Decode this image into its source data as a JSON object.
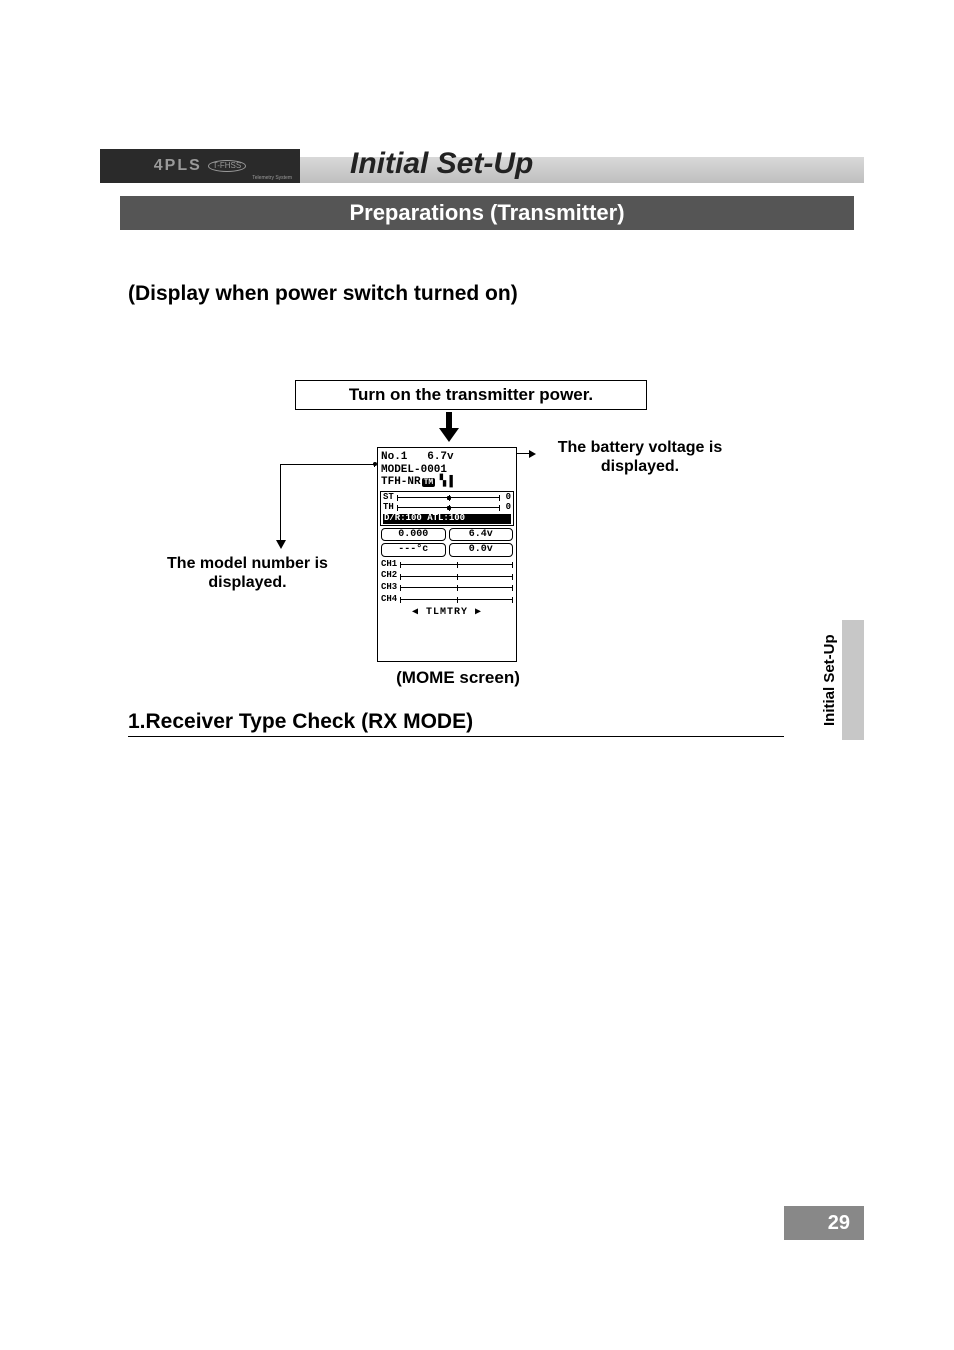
{
  "header": {
    "logo": "4PLS",
    "logo_badge": "T-FHSS",
    "logo_sub": "Telemetry System",
    "title": "Initial Set-Up",
    "section": "Preparations (Transmitter)"
  },
  "sub_heading": "(Display when power switch turned on)",
  "instruction": "Turn on the transmitter power.",
  "callouts": {
    "right": "The battery voltage  is displayed.",
    "left": "The model number is displayed.",
    "mome": "(MOME screen)"
  },
  "lcd": {
    "line1_left": "No.1",
    "line1_right": "6.7v",
    "line2": "MODEL-0001",
    "line3_prefix": "TFH-NR",
    "line3_icons": [
      "TM",
      "↕"
    ],
    "box1": {
      "st": "ST",
      "st_val": "0",
      "th": "TH",
      "th_val": "0",
      "dr": "D/R:100",
      "atl": "ATL:100"
    },
    "row_pills": [
      "0.000",
      "6.4v"
    ],
    "row_pills2": [
      "---°c",
      "0.0v"
    ],
    "channels": [
      "CH1",
      "CH2",
      "CH3",
      "CH4"
    ],
    "bottom": "TLMTRY"
  },
  "section1": "1.Receiver Type Check (RX MODE)",
  "side_tab": "Initial Set-Up",
  "page_number": "29"
}
